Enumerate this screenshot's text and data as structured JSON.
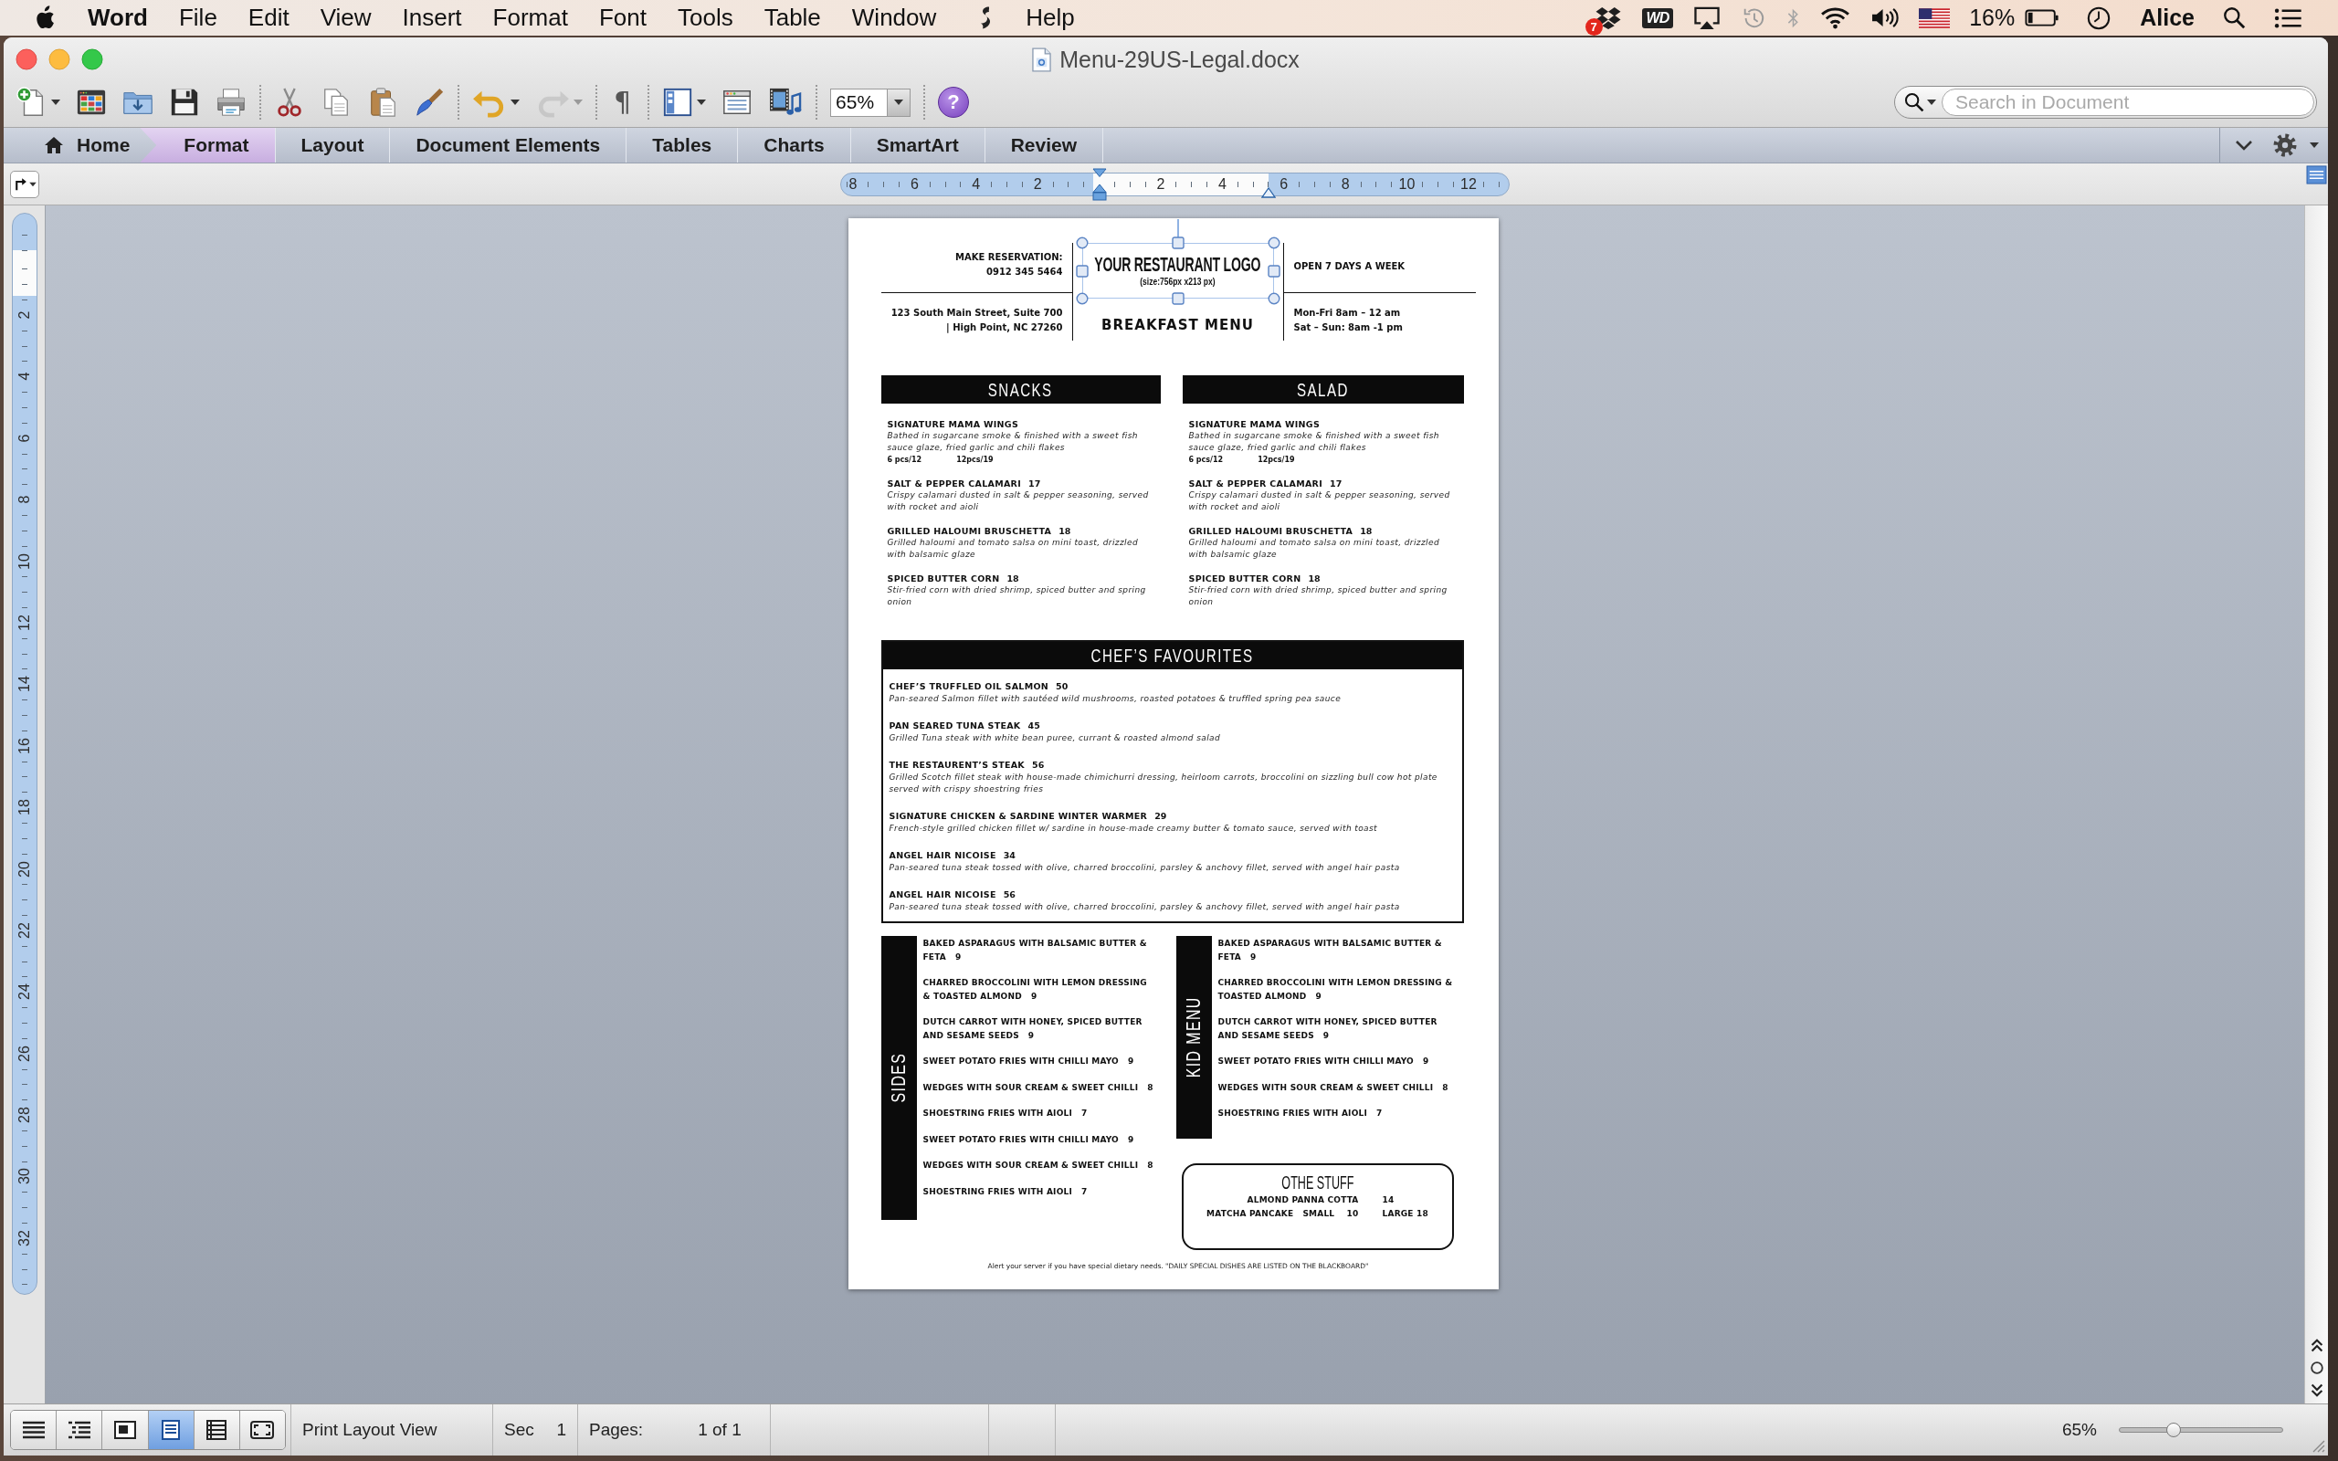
{
  "menu_bar": {
    "app": "Word",
    "menus": [
      "File",
      "Edit",
      "View",
      "Insert",
      "Format",
      "Font",
      "Tools",
      "Table",
      "Window"
    ],
    "help": "Help",
    "dropbox_badge": "7",
    "drive_label": "WD",
    "battery": "16%",
    "user": "Alice"
  },
  "window": {
    "title": "Menu-29US-Legal.docx"
  },
  "toolbar": {
    "groups": [
      [
        {
          "kind": "new",
          "dropdown": true,
          "disabled": false
        },
        {
          "kind": "gallery",
          "dropdown": false,
          "disabled": false
        },
        {
          "kind": "open",
          "dropdown": false,
          "disabled": false
        },
        {
          "kind": "save",
          "dropdown": false,
          "disabled": false
        },
        {
          "kind": "print",
          "dropdown": false,
          "disabled": false
        }
      ],
      [
        {
          "kind": "cut",
          "dropdown": false,
          "disabled": false
        },
        {
          "kind": "copy",
          "dropdown": false,
          "disabled": false
        },
        {
          "kind": "paste",
          "dropdown": false,
          "disabled": false
        },
        {
          "kind": "painter",
          "dropdown": false,
          "disabled": false
        }
      ],
      [
        {
          "kind": "undo",
          "dropdown": true,
          "disabled": false
        },
        {
          "kind": "redo",
          "dropdown": true,
          "disabled": true
        }
      ],
      [
        {
          "kind": "pilcrow",
          "label": "¶",
          "dropdown": false,
          "disabled": false
        }
      ],
      [
        {
          "kind": "layout",
          "dropdown": true,
          "disabled": false
        },
        {
          "kind": "toolbox",
          "dropdown": false,
          "disabled": false
        },
        {
          "kind": "media",
          "dropdown": false,
          "disabled": false
        }
      ],
      [
        {
          "kind": "zoom",
          "value": "65%",
          "dropdown": true,
          "disabled": false
        }
      ],
      [
        {
          "kind": "help",
          "label": "?",
          "dropdown": false,
          "disabled": false
        }
      ]
    ],
    "search": {
      "placeholder": "Search in Document"
    }
  },
  "ribbon": {
    "tabs": [
      {
        "kind": "home",
        "label": "Home",
        "selected": false
      },
      {
        "kind": "tab",
        "label": "Format",
        "selected": true
      },
      {
        "kind": "tab",
        "label": "Layout",
        "selected": false
      },
      {
        "kind": "tab",
        "label": "Document Elements",
        "selected": false
      },
      {
        "kind": "tab",
        "label": "Tables",
        "selected": false
      },
      {
        "kind": "tab",
        "label": "Charts",
        "selected": false
      },
      {
        "kind": "tab",
        "label": "SmartArt",
        "selected": false
      },
      {
        "kind": "tab",
        "label": "Review",
        "selected": false
      }
    ]
  },
  "horizontal_ruler": {
    "left_labels": [
      "8",
      "6",
      "4",
      "2"
    ],
    "right_labels": [
      "2",
      "4",
      "6",
      "8",
      "10",
      "12"
    ]
  },
  "vertical_ruler": {
    "labels": [
      "2",
      "4",
      "6",
      "8",
      "10",
      "12",
      "14",
      "16",
      "18",
      "20",
      "22",
      "24",
      "26",
      "28",
      "30",
      "32"
    ]
  },
  "document": {
    "header": {
      "reservation_label": "MAKE RESERVATION:",
      "phone": "0912 345 5464",
      "logo": {
        "title": "YOUR RESTAURANT LOGO",
        "note": "(size:756px x213 px)",
        "selected": true
      },
      "open_days": "OPEN 7 DAYS A WEEK",
      "address": [
        "123 South Main Street, Suite 700",
        "| High Point, NC 27260"
      ],
      "title": "BREAKFAST MENU",
      "hours": [
        "Mon-Fri 8am – 12 am",
        "Sat – Sun: 8am -1 pm"
      ]
    },
    "columns": [
      {
        "title": "SNACKS",
        "items": [
          {
            "name": "SIGNATURE MAMA WINGS",
            "description": "Bathed in sugarcane smoke & finished with a sweet fish sauce glaze, fried garlic and chili flakes",
            "sizes": [
              "6 pcs/12",
              "12pcs/19"
            ]
          },
          {
            "name": "SALT & PEPPER CALAMARI",
            "price": "17",
            "description": "Crispy calamari dusted in salt & pepper seasoning, served with rocket and aioli"
          },
          {
            "name": "GRILLED HALOUMI BRUSCHETTA",
            "price": "18",
            "description": "Grilled haloumi and tomato salsa on mini toast, drizzled with balsamic glaze"
          },
          {
            "name": "SPICED BUTTER CORN",
            "price": "18",
            "description": "Stir-fried corn with dried shrimp, spiced butter and spring onion"
          }
        ]
      },
      {
        "title": "SALAD",
        "items": [
          {
            "name": "SIGNATURE MAMA WINGS",
            "description": "Bathed in sugarcane smoke & finished with a sweet fish sauce glaze, fried garlic and chili flakes",
            "sizes": [
              "6 pcs/12",
              "12pcs/19"
            ]
          },
          {
            "name": "SALT & PEPPER CALAMARI",
            "price": "17",
            "description": "Crispy calamari dusted in salt & pepper seasoning, served with rocket and aioli"
          },
          {
            "name": "GRILLED HALOUMI BRUSCHETTA",
            "price": "18",
            "description": "Grilled haloumi and tomato salsa on mini toast, drizzled with balsamic glaze"
          },
          {
            "name": "SPICED BUTTER CORN",
            "price": "18",
            "description": "Stir-fried corn with dried shrimp, spiced butter and spring onion"
          }
        ]
      }
    ],
    "favourites": {
      "title": "CHEF’S FAVOURITES",
      "items": [
        {
          "name": "CHEF’S TRUFFLED OIL SALMON",
          "price": "50",
          "description": "Pan-seared Salmon fillet with sautéed wild mushrooms, roasted potatoes & truffled spring pea sauce"
        },
        {
          "name": "PAN SEARED TUNA STEAK",
          "price": "45",
          "description": "Grilled Tuna steak with white bean puree, currant & roasted almond salad"
        },
        {
          "name": "THE RESTAURENT’S STEAK",
          "price": "56",
          "description": "Grilled Scotch fillet steak with house-made chimichurri dressing, heirloom carrots, broccolini on sizzling bull cow hot plate served with crispy shoestring fries"
        },
        {
          "name": "SIGNATURE CHICKEN & SARDINE WINTER WARMER",
          "price": "29",
          "description": "French-style grilled chicken fillet w/ sardine in house-made creamy butter & tomato sauce, served with toast"
        },
        {
          "name": "ANGEL HAIR NICOISE",
          "price": "34",
          "description": "Pan-seared tuna steak tossed with olive, charred broccolini, parsley & anchovy fillet, served with angel hair pasta"
        },
        {
          "name": "ANGEL HAIR NICOISE",
          "price": "56",
          "description": "Pan-seared tuna steak tossed with olive, charred broccolini, parsley & anchovy fillet, served with angel hair pasta"
        }
      ]
    },
    "sides": {
      "title": "SIDES",
      "items": [
        {
          "name": "BAKED ASPARAGUS WITH BALSAMIC BUTTER & FETA",
          "price": "9"
        },
        {
          "name": "CHARRED BROCCOLINI WITH LEMON DRESSING & TOASTED ALMOND",
          "price": "9"
        },
        {
          "name": "DUTCH CARROT WITH HONEY, SPICED BUTTER AND SESAME SEEDS",
          "price": "9"
        },
        {
          "name": "SWEET POTATO FRIES WITH CHILLI MAYO",
          "price": "9"
        },
        {
          "name": "WEDGES WITH SOUR CREAM & SWEET CHILLI",
          "price": "8"
        },
        {
          "name": "SHOESTRING FRIES WITH AIOLI",
          "price": "7"
        },
        {
          "name": "SWEET POTATO FRIES WITH CHILLI MAYO",
          "price": "9"
        },
        {
          "name": "WEDGES WITH SOUR CREAM & SWEET CHILLI",
          "price": "8"
        },
        {
          "name": "SHOESTRING FRIES WITH AIOLI",
          "price": "7"
        }
      ]
    },
    "kids": {
      "title": "KID MENU",
      "items": [
        {
          "name": "BAKED ASPARAGUS WITH BALSAMIC BUTTER & FETA",
          "price": "9"
        },
        {
          "name": "CHARRED BROCCOLINI WITH LEMON DRESSING & TOASTED ALMOND",
          "price": "9"
        },
        {
          "name": "DUTCH CARROT WITH HONEY, SPICED BUTTER AND SESAME SEEDS",
          "price": "9"
        },
        {
          "name": "SWEET POTATO FRIES WITH CHILLI MAYO",
          "price": "9"
        },
        {
          "name": "WEDGES WITH SOUR CREAM & SWEET CHILLI",
          "price": "8"
        },
        {
          "name": "SHOESTRING FRIES WITH AIOLI",
          "price": "7"
        }
      ]
    },
    "other": {
      "title": "OTHE STUFF",
      "rows": [
        [
          "ALMOND PANNA COTTA",
          "14"
        ],
        [
          "MATCHA PANCAKE   SMALL    10",
          "LARGE 18"
        ]
      ]
    },
    "note": "Alert your server if you have special dietary needs. \"DAILY SPECIAL DISHES ARE LISTED ON THE BLACKBOARD\""
  },
  "status_bar": {
    "views": [
      {
        "kind": "draft",
        "selected": false
      },
      {
        "kind": "outline",
        "selected": false
      },
      {
        "kind": "publishing",
        "selected": false
      },
      {
        "kind": "print",
        "selected": true
      },
      {
        "kind": "notebook",
        "selected": false
      },
      {
        "kind": "focus",
        "selected": false
      }
    ],
    "view_name": "Print Layout View",
    "section_label": "Sec",
    "section": "1",
    "pages_label": "Pages:",
    "pages": "1 of 1",
    "zoom": "65%",
    "zoom_slider": {
      "level": 0.33
    }
  }
}
